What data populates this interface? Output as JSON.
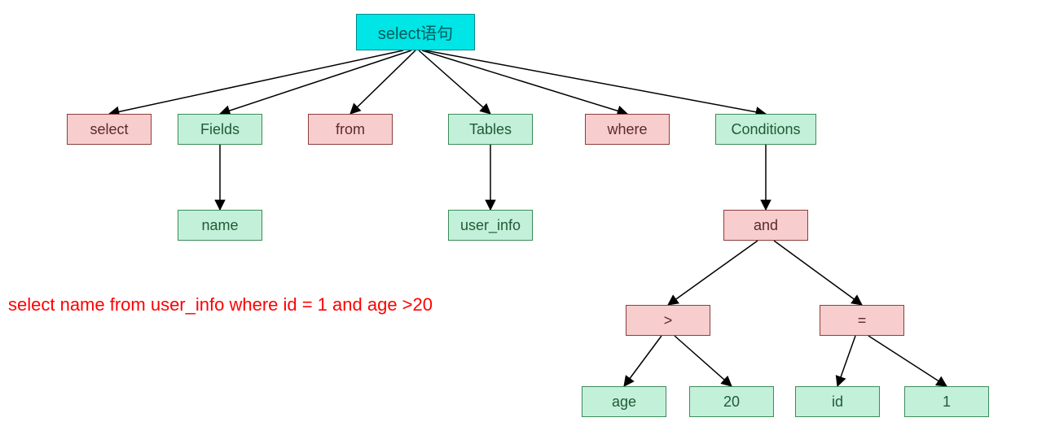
{
  "root": {
    "label": "select语句"
  },
  "level1": {
    "select": {
      "label": "select"
    },
    "fields": {
      "label": "Fields"
    },
    "from": {
      "label": "from"
    },
    "tables": {
      "label": "Tables"
    },
    "where": {
      "label": "where"
    },
    "conditions": {
      "label": "Conditions"
    }
  },
  "level2": {
    "name": {
      "label": "name"
    },
    "user_info": {
      "label": "user_info"
    },
    "and": {
      "label": "and"
    }
  },
  "level3": {
    "gt": {
      "label": ">"
    },
    "eq": {
      "label": "="
    }
  },
  "leaves": {
    "age": {
      "label": "age"
    },
    "v20": {
      "label": "20"
    },
    "id": {
      "label": "id"
    },
    "v1": {
      "label": "1"
    }
  },
  "caption": "select name from user_info where id = 1 and age >20",
  "colors": {
    "root_bg": "#00e5e5",
    "pink_bg": "#f8cdcd",
    "green_bg": "#c3f0d8",
    "caption": "#ff0000"
  }
}
